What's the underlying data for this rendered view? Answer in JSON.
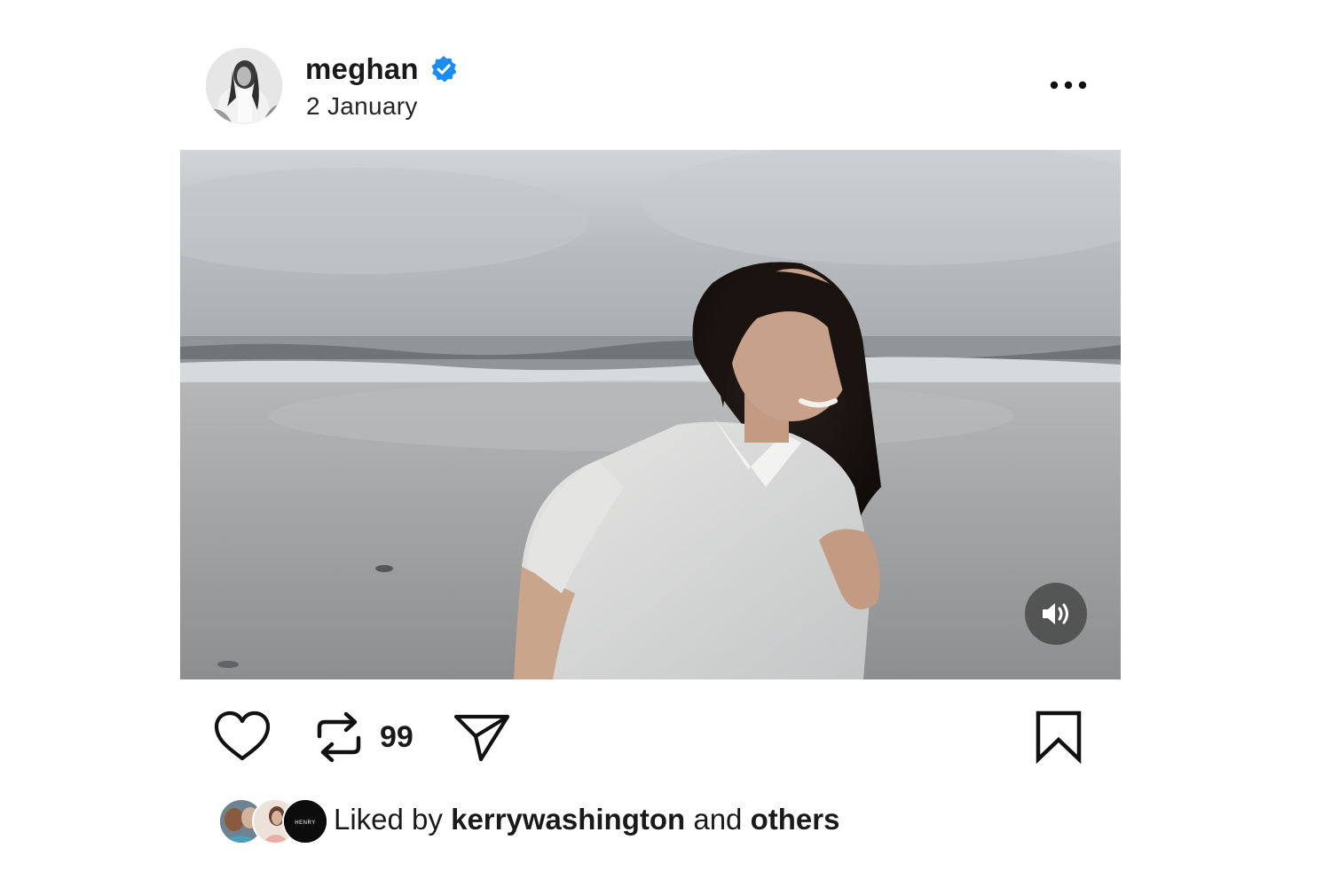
{
  "post": {
    "username": "meghan",
    "verified": true,
    "date": "2 January",
    "more_icon": "more-horizontal-icon"
  },
  "media": {
    "type": "video",
    "sound_icon": "speaker-on-icon"
  },
  "actions": {
    "like_icon": "heart-outline-icon",
    "repost_icon": "repost-icon",
    "repost_count": "99",
    "share_icon": "paper-plane-icon",
    "save_icon": "bookmark-outline-icon"
  },
  "likes": {
    "prefix": "Liked by",
    "user": "kerrywashington",
    "connector": "and",
    "suffix": "others",
    "avatar3_text": "HENRY"
  },
  "colors": {
    "verified_badge": "#1d8cf0",
    "text": "#1a1a1a"
  }
}
